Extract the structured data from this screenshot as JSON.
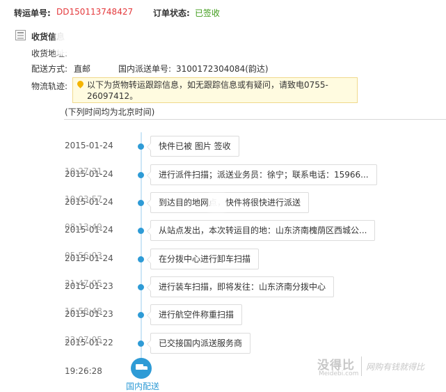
{
  "header": {
    "transfer_no_label": "转运单号:",
    "transfer_no_value": "DD150113748427",
    "order_status_label": "订单状态:",
    "order_status_value": "已签收"
  },
  "receipt": {
    "section_title": "收货信息",
    "address_label": "收货地址:",
    "ship_method_label": "配送方式:",
    "ship_method_value": "直邮",
    "domestic_no_label": "国内派送单号:",
    "domestic_no_value": "3100172304084(韵达)",
    "track_label": "物流轨迹:",
    "notice_text": "以下为货物转运跟踪信息，如无跟踪信息或有疑问，请致电0755-26097412。",
    "timezone_note": "(下列时间均为北京时间)"
  },
  "timeline": [
    {
      "date": "2015-01-24",
      "ghost": "",
      "event": "快件已被 图片 签收"
    },
    {
      "date": "2015-01-24",
      "ghost": "10:27:31",
      "event": "进行派件扫描；派送业务员：徐宁；联系电话：15966..."
    },
    {
      "date": "2015-01-24",
      "ghost": "10:03:57",
      "event": "到达目的地网点，快件将很快进行派送"
    },
    {
      "date": "2015-01-24",
      "ghost": "08:13:49",
      "event": "从站点发出，本次转运目的地：山东济南槐荫区西城公..."
    },
    {
      "date": "2015-01-24",
      "ghost": "05:56:03",
      "event": "在分拨中心进行卸车扫描"
    },
    {
      "date": "2015-01-23",
      "ghost": "21:47:05",
      "event": "进行装车扫描，即将发往：山东济南分拨中心"
    },
    {
      "date": "2015-01-23",
      "ghost": "16:58:48",
      "event": "进行航空件称重扫描"
    },
    {
      "date": "2015-01-22",
      "ghost": "23:07:05",
      "event": "已交接国内派送服务商"
    }
  ],
  "last_time": "19:26:28",
  "bottom_node": {
    "icon": "truck-icon",
    "label": "国内配送"
  },
  "watermark": {
    "logo": "没得比",
    "sub": "Meidebi.com",
    "slogan": "网购有钱就得比"
  },
  "colors": {
    "accent": "#2e9bd6",
    "order_no": "#e4393c",
    "status": "#3f9b1a"
  }
}
